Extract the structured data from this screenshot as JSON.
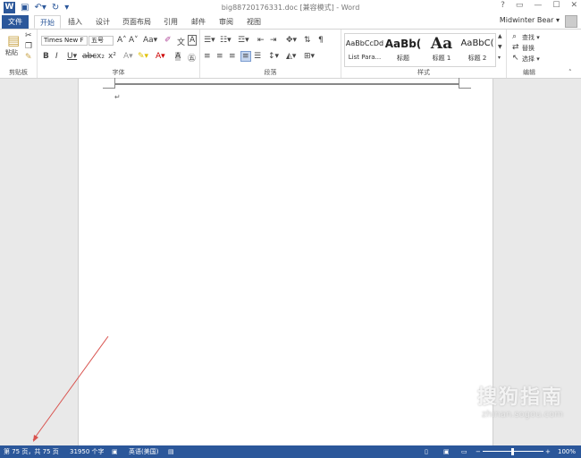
{
  "titlebar": {
    "document_title": "big88720176331.doc [兼容模式] - Word",
    "controls": [
      "?",
      "▭",
      "—",
      "☐",
      "✕"
    ]
  },
  "tabs": [
    "文件",
    "开始",
    "插入",
    "设计",
    "页面布局",
    "引用",
    "邮件",
    "审阅",
    "视图"
  ],
  "account": {
    "name": "Midwinter Bear ▾"
  },
  "ribbon": {
    "clipboard": {
      "paste": "粘贴",
      "label": "剪贴板"
    },
    "font": {
      "font_name": "Times New F",
      "font_size": "五号",
      "label": "字体"
    },
    "paragraph": {
      "label": "段落"
    },
    "styles": {
      "label": "样式",
      "items": [
        {
          "sample": "AaBbCcDd",
          "name": "List Para..."
        },
        {
          "sample": "AaBb(",
          "name": "标题"
        },
        {
          "sample": "Aa",
          "name": "标题 1"
        },
        {
          "sample": "AaBbC(",
          "name": "标题 2"
        }
      ]
    },
    "editing": {
      "find": "查找 ▾",
      "replace": "替换",
      "select": "选择 ▾",
      "label": "编辑"
    }
  },
  "document": {
    "paragraph_mark": "↵"
  },
  "watermark": {
    "title": "搜狗指南",
    "url": "zhinan.sogou.com"
  },
  "statusbar": {
    "page": "第 75 页，共 75 页",
    "words": "31950 个字",
    "language": "英语(美国)",
    "zoom": "100%"
  },
  "colors": {
    "accent": "#2b579a"
  }
}
